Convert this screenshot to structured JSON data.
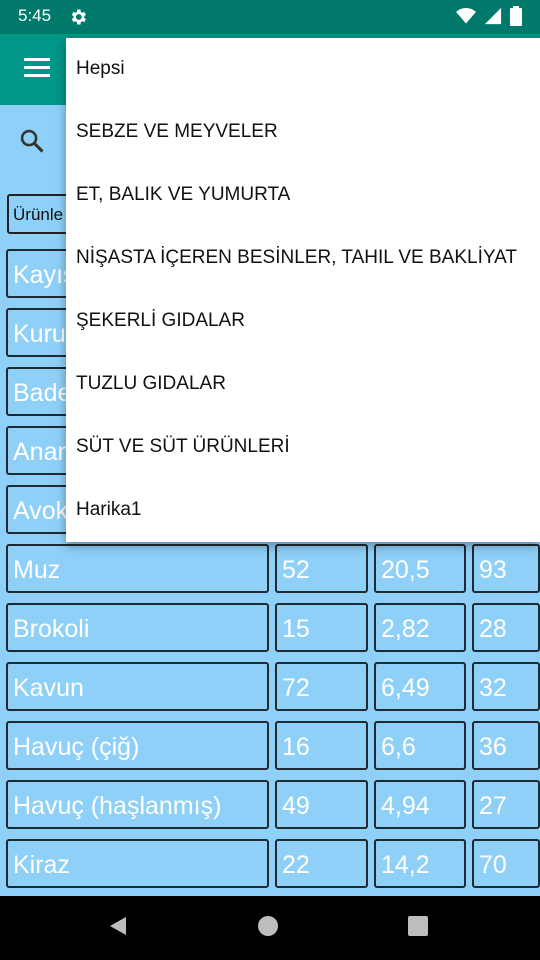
{
  "status": {
    "time": "5:45",
    "icons": [
      "settings-gear-icon",
      "wifi-icon",
      "cellular-signal-icon",
      "battery-icon"
    ]
  },
  "toolbar": {
    "menu_icon": "hamburger-menu-icon"
  },
  "search": {
    "icon": "search-icon"
  },
  "filter": {
    "value": "Ürünle"
  },
  "rows": [
    {
      "name": "Kayısı",
      "a": "",
      "b": "",
      "c": ""
    },
    {
      "name": "Kuru",
      "a": "",
      "b": "",
      "c": ""
    },
    {
      "name": "Badem",
      "a": "",
      "b": "",
      "c": ""
    },
    {
      "name": "Ananas",
      "a": "",
      "b": "",
      "c": ""
    },
    {
      "name": "Avokado",
      "a": "",
      "b": "",
      "c": ""
    },
    {
      "name": "Muz",
      "a": "52",
      "b": "20,5",
      "c": "93"
    },
    {
      "name": "Brokoli",
      "a": "15",
      "b": "2,82",
      "c": "28"
    },
    {
      "name": "Kavun",
      "a": "72",
      "b": "6,49",
      "c": "32"
    },
    {
      "name": "Havuç (çiğ)",
      "a": "16",
      "b": "6,6",
      "c": "36"
    },
    {
      "name": "Havuç (haşlanmış)",
      "a": "49",
      "b": "4,94",
      "c": "27"
    },
    {
      "name": "Kiraz",
      "a": "22",
      "b": "14,2",
      "c": "70"
    }
  ],
  "dropdown": {
    "items": [
      "Hepsi",
      "SEBZE VE MEYVELER",
      "ET, BALIK VE YUMURTA",
      "NİŞASTA İÇEREN BESİNLER, TAHIL VE BAKLİYAT",
      "ŞEKERLİ GIDALAR",
      "TUZLU GIDALAR",
      "SÜT VE SÜT ÜRÜNLERİ",
      "Harika1"
    ]
  },
  "nav": {
    "icons": [
      "back-icon",
      "home-icon",
      "recent-apps-icon"
    ]
  },
  "colors": {
    "status_bar": "#00796b",
    "toolbar": "#009688",
    "background": "#8fd0f8"
  }
}
